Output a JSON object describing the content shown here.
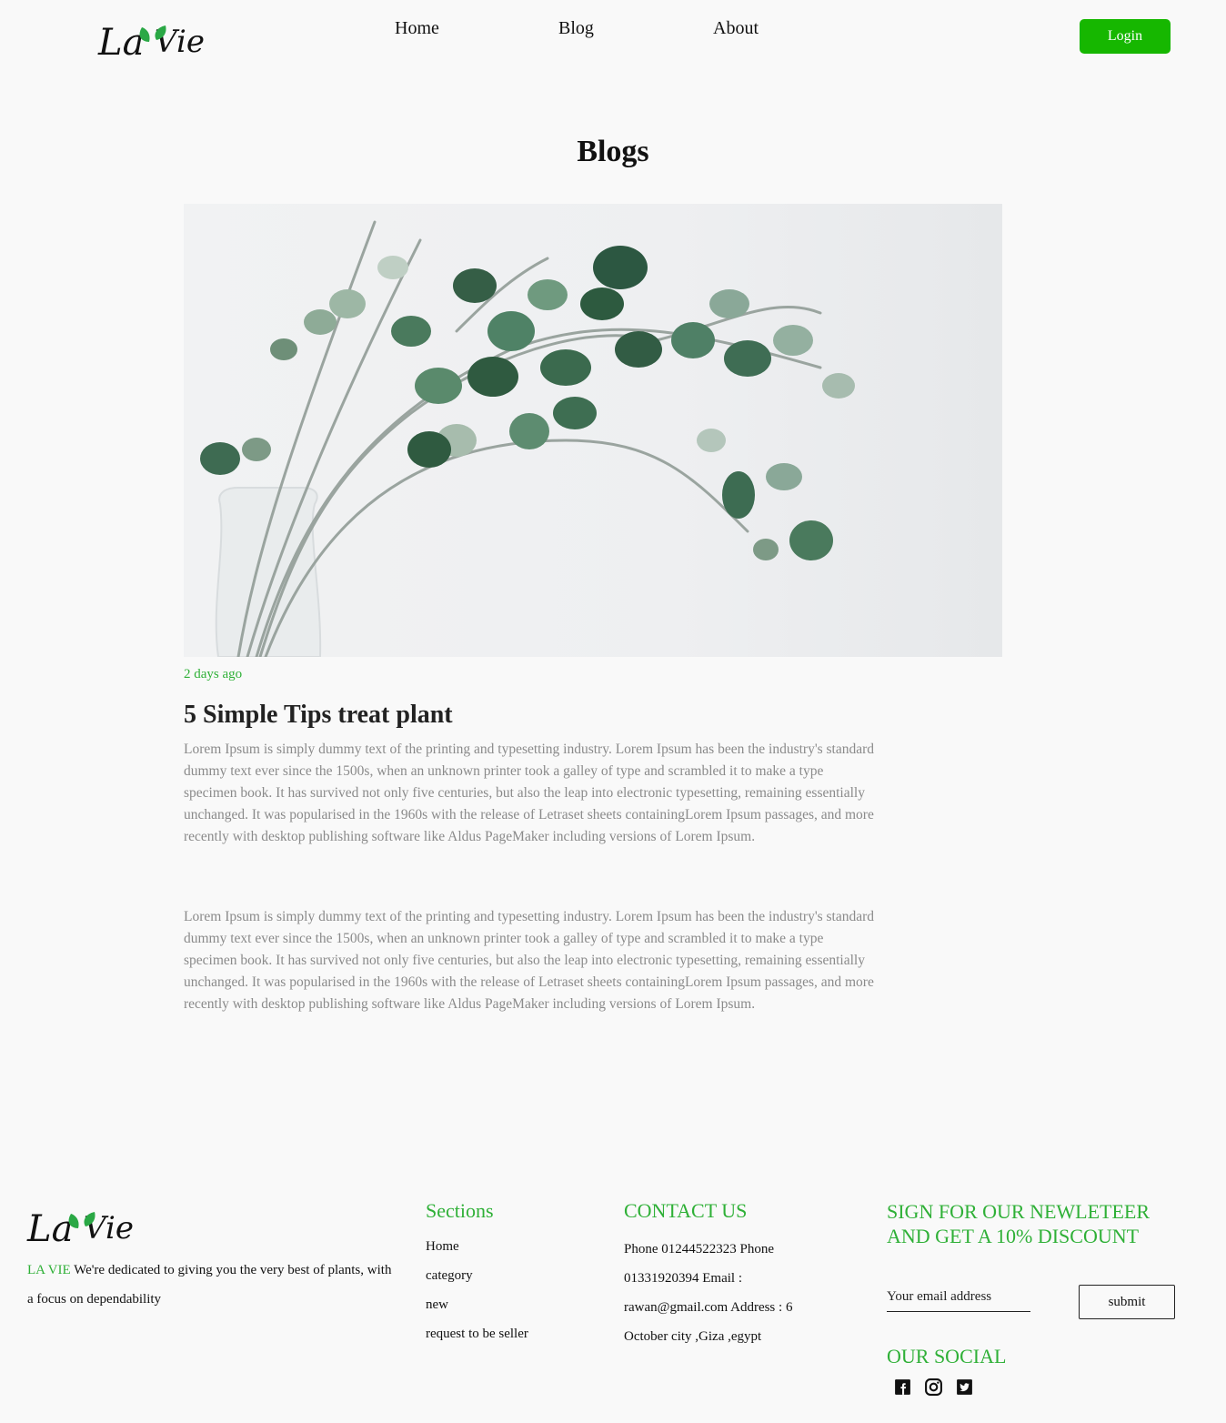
{
  "header": {
    "logo_text": "La Vie",
    "nav": [
      {
        "label": "Home"
      },
      {
        "label": "Blog"
      },
      {
        "label": "About"
      }
    ],
    "login_label": "Login"
  },
  "main": {
    "title": "Blogs",
    "post": {
      "date": "2 days ago",
      "title": "5 Simple Tips treat plant",
      "paragraphs": [
        "Lorem Ipsum is simply dummy text of the printing and typesetting industry. Lorem Ipsum has been the industry's standard dummy text ever since the 1500s, when an unknown printer took a galley of type and scrambled it to make a type specimen book. It has survived not only five centuries, but also the leap into electronic typesetting, remaining essentially unchanged. It was popularised in the 1960s with the release of Letraset sheets containingLorem Ipsum passages, and more recently with desktop publishing software like Aldus PageMaker including versions of Lorem Ipsum.",
        "Lorem Ipsum is simply dummy text of the printing and typesetting industry. Lorem Ipsum has been the industry's standard dummy text ever since the 1500s, when an unknown printer took a galley of type and scrambled it to make a type specimen book. It has survived not only five centuries, but also the leap into electronic typesetting, remaining essentially unchanged. It was popularised in the 1960s with the release of Letraset sheets containingLorem Ipsum passages, and more recently with desktop publishing software like Aldus PageMaker including versions of Lorem Ipsum."
      ]
    }
  },
  "footer": {
    "logo_text": "La Vie",
    "about_brand": "LA VIE",
    "about_text": " We're dedicated to giving you the very best of plants, with a focus on dependability",
    "sections_heading": "Sections",
    "sections": [
      "Home",
      "category",
      "new",
      "request to be seller"
    ],
    "contact_heading": "CONTACT US",
    "contact_text": "Phone 01244522323 Phone 01331920394 Email : rawan@gmail.com Address : 6 October city ,Giza ,egypt",
    "newsletter_heading": "SIGN FOR OUR NEWLETEER AND GET A 10% DISCOUNT",
    "email_placeholder": "Your email address",
    "submit_label": "submit",
    "social_heading": "OUR SOCIAL",
    "social_icons": [
      "facebook-icon",
      "instagram-icon",
      "twitter-icon"
    ]
  },
  "colors": {
    "accent_green": "#2fb037",
    "login_green": "#16b700",
    "background": "#f9f9f9",
    "body_text_gray": "#8a8a8a"
  }
}
